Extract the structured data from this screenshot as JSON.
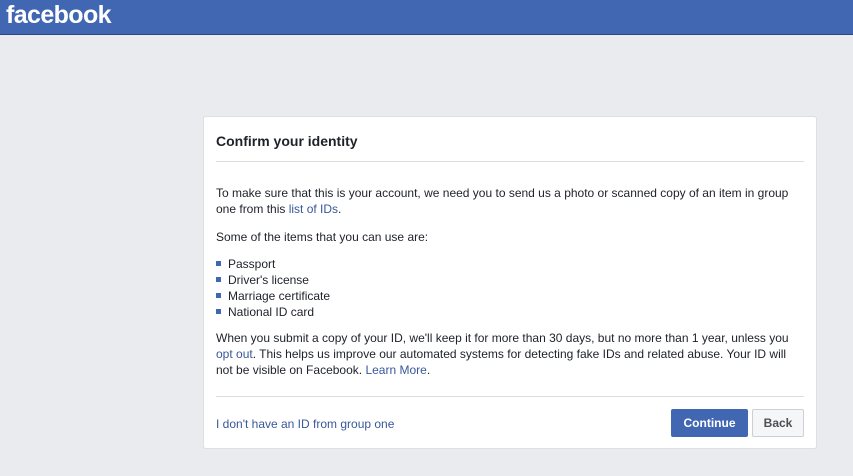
{
  "header": {
    "logo_text": "facebook"
  },
  "card": {
    "title": "Confirm your identity",
    "intro_before_link": "To make sure that this is your account, we need you to send us a photo or scanned copy of an item in group one from this ",
    "intro_link": "list of IDs",
    "intro_after_link": ".",
    "items_intro": "Some of the items that you can use are:",
    "id_items": [
      "Passport",
      "Driver's license",
      "Marriage certificate",
      "National ID card"
    ],
    "retention_before_opt_out": "When you submit a copy of your ID, we'll keep it for more than 30 days, but no more than 1 year, unless you ",
    "retention_opt_out_link": "opt out",
    "retention_middle": ". This helps us improve our automated systems for detecting fake IDs and related abuse. Your ID will not be visible on Facebook. ",
    "retention_learn_more_link": "Learn More",
    "retention_end": "."
  },
  "footer": {
    "no_id_link": "I don't have an ID from group one",
    "continue_label": "Continue",
    "back_label": "Back"
  },
  "colors": {
    "brand": "#4267b2",
    "link": "#385898",
    "page_background": "#e9ebee"
  }
}
